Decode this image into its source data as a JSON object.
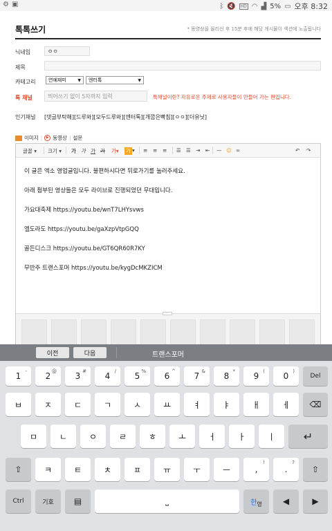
{
  "status_bar": {
    "left_icons": [
      "settings-icon",
      "image-icon"
    ],
    "right_icons": [
      "bluetooth-icon",
      "mute-icon",
      "hd-icon",
      "wifi-icon",
      "signal-icon"
    ],
    "battery": "5%",
    "battery_icon": "battery-icon",
    "time": "오후 8:32"
  },
  "page": {
    "title": "톡톡쓰기",
    "notice": "* 동영상을 올리신 후 15분 후에 해당 게시물이 섹션에 노출됩니다",
    "nickname_label": "닉네임",
    "nickname_value": "ㅇㅇ",
    "subject_label": "제목",
    "subject_value": "",
    "category_label": "카테고리",
    "category_primary": "연예재미",
    "category_secondary": "엔터톡",
    "channel_label": "톡 채널",
    "channel_placeholder": "띄어쓰기 없이 5자까지 입력",
    "channel_warning": "톡채널이란? 자유로운 주제로 사용자들이 만들어 가는 판입니다.",
    "popular_label": "인기채널",
    "popular_tags": "[댓글부탁해][드루와][모두드루와][엔터톡][개깝은빡침][ㅇㅇ][더유닛]"
  },
  "attach_bar": {
    "image_label": "이미지",
    "video_label": "동영상",
    "poll_label": "설문"
  },
  "toolbar": {
    "font_label": "글꼴",
    "size_label": "크기",
    "bold": "가",
    "italic": "가",
    "underline": "가",
    "strike": "가",
    "color": "가",
    "highlight": "가",
    "accent_color": "#f5a623"
  },
  "editor": {
    "lines": [
      "이 글은 엑소 영업글입니다. 불편하시다면 뒤로가기를 눌러주세요.",
      "아래 첨부된 영상들은 모두 라이브로 진행되었던 무대입니다.",
      "가요대축제 https://youtu.be/wnT7LHYsvws",
      "엘도라도 https://youtu.be/gaXzpVtpGQQ",
      "골든디스크 https://youtu.be/GT6QR60R7KY",
      "무반주 트랜스포머 https://youtu.be/kygDcMKZICM"
    ]
  },
  "keyboard": {
    "prev_label": "이전",
    "next_label": "다음",
    "suggestion": "트랜스포머",
    "row1": [
      {
        "main": "1",
        "sup": "-"
      },
      {
        "main": "2",
        "sup": "@"
      },
      {
        "main": "3",
        "sup": "#"
      },
      {
        "main": "4",
        "sup": "/"
      },
      {
        "main": "5",
        "sup": "%"
      },
      {
        "main": "6",
        "sup": "^"
      },
      {
        "main": "7",
        "sup": "&"
      },
      {
        "main": "8",
        "sup": "*"
      },
      {
        "main": "9",
        "sup": "("
      },
      {
        "main": "0",
        "sup": ")"
      }
    ],
    "del_label": "Del",
    "row2": [
      "ㅂ",
      "ㅈ",
      "ㄷ",
      "ㄱ",
      "ㅅ",
      "ㅛ",
      "ㅕ",
      "ㅑ",
      "ㅐ",
      "ㅔ"
    ],
    "row3": [
      "ㅁ",
      "ㄴ",
      "ㅇ",
      "ㄹ",
      "ㅎ",
      "ㅗ",
      "ㅓ",
      "ㅏ",
      "ㅣ"
    ],
    "row4": [
      "ㅋ",
      "ㅌ",
      "ㅊ",
      "ㅍ",
      "ㅠ",
      "ㅜ",
      "ㅡ"
    ],
    "comma_main": ",",
    "comma_sup": "!",
    "period_main": ".",
    "period_sup": "?",
    "ctrl_label": "Ctrl",
    "symbol_label": "기호",
    "lang_main": "한",
    "lang_sub": "영"
  }
}
